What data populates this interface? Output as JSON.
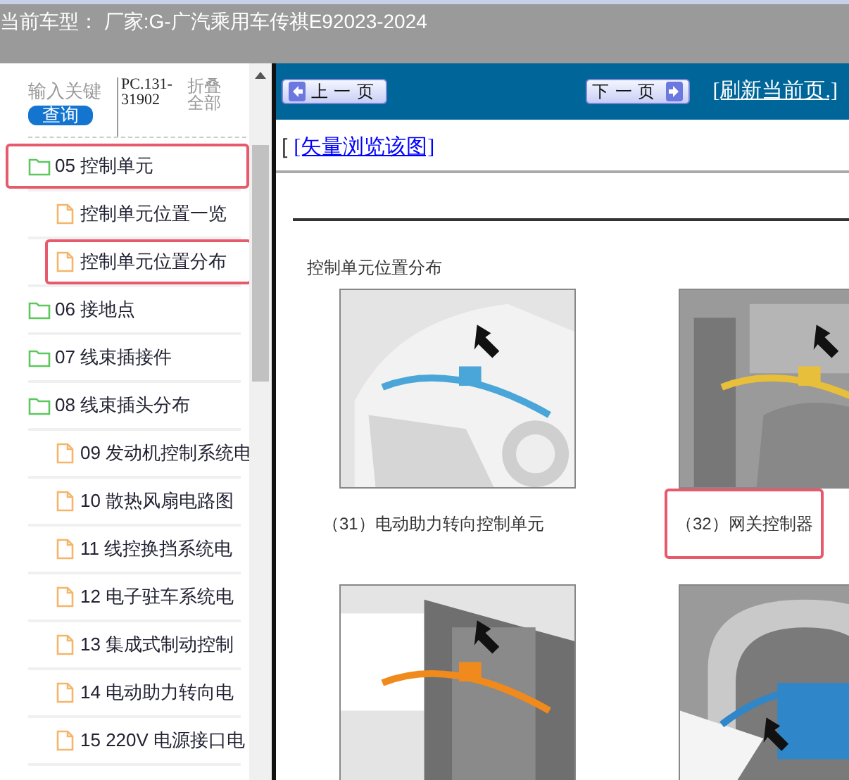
{
  "window": {
    "title": "当前车型： 厂家:G-广汽乘用车传祺E92023-2024"
  },
  "search": {
    "placeholder": "输入关键",
    "button": "查询"
  },
  "code": "PC.131-31902",
  "collapse_all": "折叠全部",
  "tree": [
    {
      "label": "05 控制单元",
      "kind": "folder",
      "highlighted": true,
      "children": [
        {
          "label": "控制单元位置一览",
          "kind": "page",
          "highlighted": false
        },
        {
          "label": "控制单元位置分布",
          "kind": "page",
          "highlighted": true
        }
      ]
    },
    {
      "label": "06 接地点",
      "kind": "folder",
      "highlighted": false
    },
    {
      "label": "07 线束插接件",
      "kind": "folder",
      "highlighted": false
    },
    {
      "label": "08 线束插头分布",
      "kind": "folder",
      "highlighted": false,
      "children": [
        {
          "label": "09 发动机控制系统电",
          "kind": "page",
          "highlighted": false
        },
        {
          "label": "10 散热风扇电路图",
          "kind": "page",
          "highlighted": false
        },
        {
          "label": "11 线控换挡系统电",
          "kind": "page",
          "highlighted": false
        },
        {
          "label": "12 电子驻车系统电",
          "kind": "page",
          "highlighted": false
        },
        {
          "label": "13 集成式制动控制",
          "kind": "page",
          "highlighted": false
        },
        {
          "label": "14 电动助力转向电",
          "kind": "page",
          "highlighted": false
        },
        {
          "label": "15 220V 电源接口电",
          "kind": "page",
          "highlighted": false
        }
      ]
    }
  ],
  "toolbar": {
    "prev": "上一页",
    "next": "下一页",
    "refresh": "[刷新当前页.]"
  },
  "vector_link": {
    "bracket": "[",
    "label": "[矢量浏览该图]"
  },
  "document": {
    "heading": "控制单元位置分布",
    "figures": [
      {
        "kind": "picture",
        "caption": "（31）电动助力转向控制单元",
        "highlighted": false
      },
      {
        "kind": "picture",
        "caption": "（32）网关控制器",
        "highlighted": true
      },
      {
        "kind": "picture"
      },
      {
        "kind": "picture"
      }
    ]
  }
}
